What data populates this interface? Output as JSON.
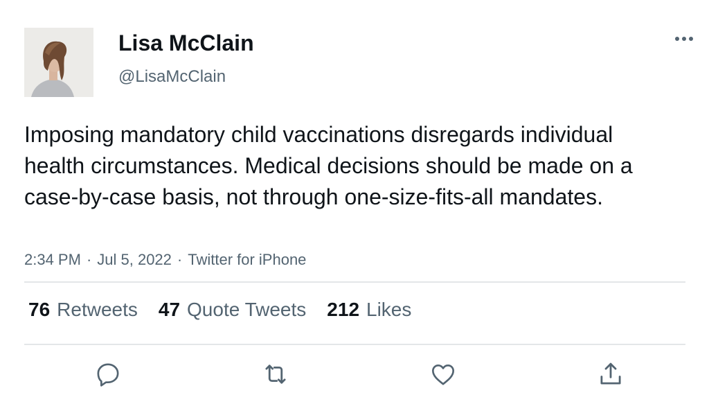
{
  "author": {
    "name": "Lisa McClain",
    "handle": "@LisaMcClain"
  },
  "tweet": {
    "text": "Imposing mandatory child vaccinations disregards individual health circumstances. Medical decisions should be made on a case-by-case basis, not through one-size-fits-all mandates.",
    "time": "2:34 PM",
    "date": "Jul 5, 2022",
    "source": "Twitter for iPhone",
    "separator": "·"
  },
  "stats": {
    "retweets_count": "76",
    "retweets_label": "Retweets",
    "quotes_count": "47",
    "quotes_label": "Quote Tweets",
    "likes_count": "212",
    "likes_label": "Likes"
  },
  "icons": {
    "more": "more-icon",
    "reply": "reply-icon",
    "retweet": "retweet-icon",
    "like": "heart-icon",
    "share": "share-icon"
  },
  "colors": {
    "text_primary": "#0f1419",
    "text_secondary": "#536471",
    "divider": "#e3e6e8",
    "icon": "#536471"
  }
}
